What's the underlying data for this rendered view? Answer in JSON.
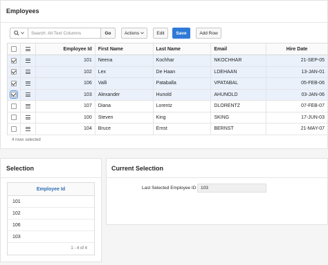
{
  "employees_region": {
    "title": "Employees",
    "search": {
      "placeholder": "Search: All Text Columns",
      "go_label": "Go"
    },
    "toolbar": {
      "actions_label": "Actions",
      "edit_label": "Edit",
      "save_label": "Save",
      "add_row_label": "Add Row"
    },
    "columns": {
      "id": "Employee Id",
      "first": "First Name",
      "last": "Last Name",
      "email": "Email",
      "hire": "Hire Date"
    },
    "rows": [
      {
        "id": "101",
        "first": "Neena",
        "last": "Kochhar",
        "email": "NKOCHHAR",
        "hire": "21-SEP-05",
        "selected": true
      },
      {
        "id": "102",
        "first": "Lex",
        "last": "De Haan",
        "email": "LDEHAAN",
        "hire": "13-JAN-01",
        "selected": true
      },
      {
        "id": "106",
        "first": "Valli",
        "last": "Pataballa",
        "email": "VPATABAL",
        "hire": "05-FEB-06",
        "selected": true
      },
      {
        "id": "103",
        "first": "Alexander",
        "last": "Hunold",
        "email": "AHUNOLD",
        "hire": "03-JAN-06",
        "selected": true
      },
      {
        "id": "107",
        "first": "Diana",
        "last": "Lorentz",
        "email": "DLORENTZ",
        "hire": "07-FEB-07",
        "selected": false
      },
      {
        "id": "100",
        "first": "Steven",
        "last": "King",
        "email": "SKING",
        "hire": "17-JUN-03",
        "selected": false
      },
      {
        "id": "104",
        "first": "Bruce",
        "last": "Ernst",
        "email": "BERNST",
        "hire": "21-MAY-07",
        "selected": false
      }
    ],
    "footer": "4 rows selected"
  },
  "selection_region": {
    "title": "Selection",
    "column": "Employee Id",
    "rows": [
      "101",
      "102",
      "106",
      "103"
    ],
    "pager": "1 - 4 of 4"
  },
  "current_selection_region": {
    "title": "Current Selection",
    "field_label": "Last Selected Employee ID",
    "field_value": "103"
  },
  "colors": {
    "accent": "#2f7ad6",
    "selected_row": "#eaf1fb",
    "link_header": "#2f6db3"
  }
}
